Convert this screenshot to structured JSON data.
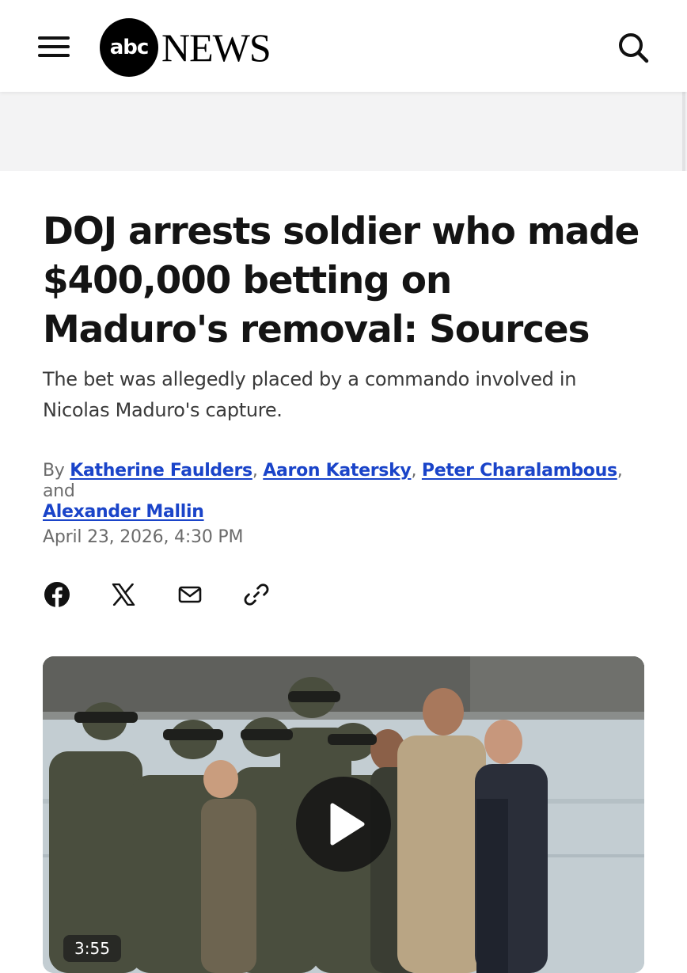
{
  "header": {
    "logo_abc": "abc",
    "logo_news": "NEWS",
    "menu_icon": "hamburger-menu-icon",
    "search_icon": "search-icon"
  },
  "article": {
    "headline": "DOJ arrests soldier who made $400,000 betting on Maduro's removal: Sources",
    "dek": "The bet was allegedly placed by a commando involved in Nicolas Maduro's capture.",
    "byline_prefix": "By",
    "authors": [
      "Katherine Faulders",
      "Aaron Katersky",
      "Peter Charalambous",
      "Alexander Mallin"
    ],
    "byline_sep": ",",
    "byline_and": "and",
    "date": "April 23, 2026, 4:30 PM"
  },
  "share": {
    "facebook_icon": "facebook-icon",
    "x_icon": "x-icon",
    "email_icon": "email-icon",
    "link_icon": "link-icon"
  },
  "media": {
    "duration": "3:55",
    "play_icon": "play-icon"
  },
  "colors": {
    "link": "#1a44c9",
    "headline": "#141414",
    "muted": "#6b6b6b"
  }
}
